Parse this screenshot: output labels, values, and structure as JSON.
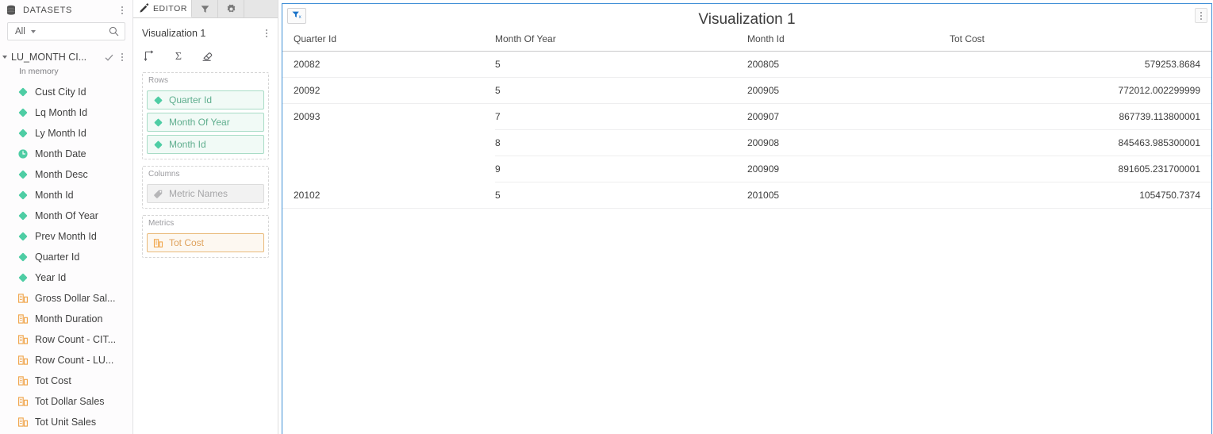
{
  "datasets_panel": {
    "header_title": "DATASETS",
    "db_icon": "database-icon",
    "kebab_icon": "more-options-icon",
    "search": {
      "selected": "All",
      "chevron_icon": "chevron-down-icon",
      "search_icon": "search-icon"
    },
    "dataset": {
      "name": "LU_MONTH CI...",
      "status": "In memory",
      "expand_icon": "triangle-expanded-icon",
      "check_icon": "check-icon",
      "kebab_icon": "more-options-icon"
    },
    "fields": [
      {
        "label": "Cust City Id",
        "icon": "attribute-diamond-icon"
      },
      {
        "label": "Lq Month Id",
        "icon": "attribute-diamond-icon"
      },
      {
        "label": "Ly Month Id",
        "icon": "attribute-diamond-icon"
      },
      {
        "label": "Month Date",
        "icon": "time-attribute-icon"
      },
      {
        "label": "Month Desc",
        "icon": "attribute-diamond-icon"
      },
      {
        "label": "Month Id",
        "icon": "attribute-diamond-icon"
      },
      {
        "label": "Month Of Year",
        "icon": "attribute-diamond-icon"
      },
      {
        "label": "Prev Month Id",
        "icon": "attribute-diamond-icon"
      },
      {
        "label": "Quarter Id",
        "icon": "attribute-diamond-icon"
      },
      {
        "label": "Year Id",
        "icon": "attribute-diamond-icon"
      },
      {
        "label": "Gross Dollar Sal...",
        "icon": "metric-bar-icon"
      },
      {
        "label": "Month Duration",
        "icon": "metric-bar-icon"
      },
      {
        "label": "Row Count - CIT...",
        "icon": "metric-bar-icon"
      },
      {
        "label": "Row Count - LU...",
        "icon": "metric-bar-icon"
      },
      {
        "label": "Tot Cost",
        "icon": "metric-bar-icon"
      },
      {
        "label": "Tot Dollar Sales",
        "icon": "metric-bar-icon"
      },
      {
        "label": "Tot Unit Sales",
        "icon": "metric-bar-icon"
      }
    ]
  },
  "editor_panel": {
    "tabs": [
      {
        "label": "EDITOR",
        "icon": "pencil-icon",
        "active": true
      },
      {
        "label": "",
        "icon": "filter-icon",
        "active": false
      },
      {
        "label": "",
        "icon": "gear-icon",
        "active": false
      }
    ],
    "visualization_name": "Visualization 1",
    "kebab_icon": "more-options-icon",
    "tools": [
      {
        "name": "swap-rows-columns-icon"
      },
      {
        "name": "totals-sigma-icon"
      },
      {
        "name": "eraser-clear-icon"
      }
    ],
    "shelves": [
      {
        "label": "Rows",
        "items": [
          {
            "label": "Quarter Id",
            "icon": "attribute-diamond-icon",
            "style": "attr"
          },
          {
            "label": "Month Of Year",
            "icon": "attribute-diamond-icon",
            "style": "attr"
          },
          {
            "label": "Month Id",
            "icon": "attribute-diamond-icon",
            "style": "attr"
          }
        ]
      },
      {
        "label": "Columns",
        "items": [
          {
            "label": "Metric Names",
            "icon": "tag-icon",
            "style": "grayed"
          }
        ]
      },
      {
        "label": "Metrics",
        "items": [
          {
            "label": "Tot Cost",
            "icon": "metric-bar-icon",
            "style": "metric"
          }
        ]
      }
    ]
  },
  "visualization": {
    "title": "Visualization 1",
    "clear_filter_icon": "clear-filter-icon",
    "kebab_icon": "more-options-icon",
    "columns": [
      "Quarter Id",
      "Month Of Year",
      "Month Id",
      "Tot Cost"
    ],
    "groups": [
      {
        "quarter_id": "20082",
        "rows": [
          {
            "month_of_year": "5",
            "month_id": "200805",
            "tot_cost": "579253.8684"
          }
        ]
      },
      {
        "quarter_id": "20092",
        "rows": [
          {
            "month_of_year": "5",
            "month_id": "200905",
            "tot_cost": "772012.002299999"
          }
        ]
      },
      {
        "quarter_id": "20093",
        "rows": [
          {
            "month_of_year": "7",
            "month_id": "200907",
            "tot_cost": "867739.113800001"
          },
          {
            "month_of_year": "8",
            "month_id": "200908",
            "tot_cost": "845463.985300001"
          },
          {
            "month_of_year": "9",
            "month_id": "200909",
            "tot_cost": "891605.231700001"
          }
        ]
      },
      {
        "quarter_id": "20102",
        "rows": [
          {
            "month_of_year": "5",
            "month_id": "201005",
            "tot_cost": "1054750.7374"
          }
        ]
      }
    ]
  },
  "colors": {
    "attribute_green": "#4ecda4",
    "metric_orange": "#f0a54a",
    "selection_blue": "#3f8fd6",
    "panel_bg": "#fdfcfd"
  }
}
